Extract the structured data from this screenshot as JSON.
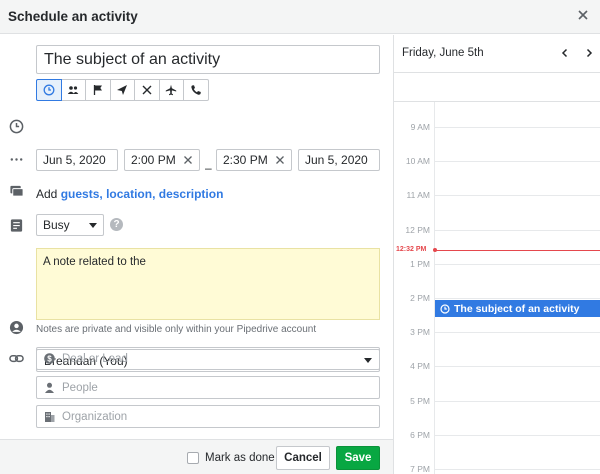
{
  "window": {
    "title": "Schedule an activity"
  },
  "form": {
    "subject_value": "The subject of an activity",
    "activity_types": [
      "call-icon",
      "meeting-icon",
      "flag-icon",
      "email-icon",
      "lunch-icon",
      "plane-icon",
      "phone-icon"
    ],
    "start_date": "Jun 5, 2020",
    "start_time": "2:00 PM",
    "end_time": "2:30 PM",
    "end_date": "Jun 5, 2020",
    "dash": "–",
    "add_prefix": "Add",
    "add_guests": "guests,",
    "add_location": "location,",
    "add_description": "description",
    "availability": "Busy",
    "help": "?",
    "note_value": "A note related to the",
    "note_hint": "Notes are private and visible only within your Pipedrive account",
    "owner": "Breandan (You)",
    "deal_placeholder": "Deal or Lead",
    "person_placeholder": "People",
    "org_placeholder": "Organization"
  },
  "footer": {
    "mark_done": "Mark as done",
    "cancel": "Cancel",
    "save": "Save"
  },
  "calendar": {
    "date": "Friday, June 5th",
    "hours": [
      "9 AM",
      "10 AM",
      "11 AM",
      "12 PM",
      "1 PM",
      "2 PM",
      "3 PM",
      "4 PM",
      "5 PM",
      "6 PM",
      "7 PM"
    ],
    "now_time": "12:32 PM",
    "event_title": "The subject of an activity"
  },
  "colors": {
    "accent": "#317ae2",
    "save": "#08a742",
    "now_line": "#e5484d",
    "note_bg": "#fffbd6"
  }
}
